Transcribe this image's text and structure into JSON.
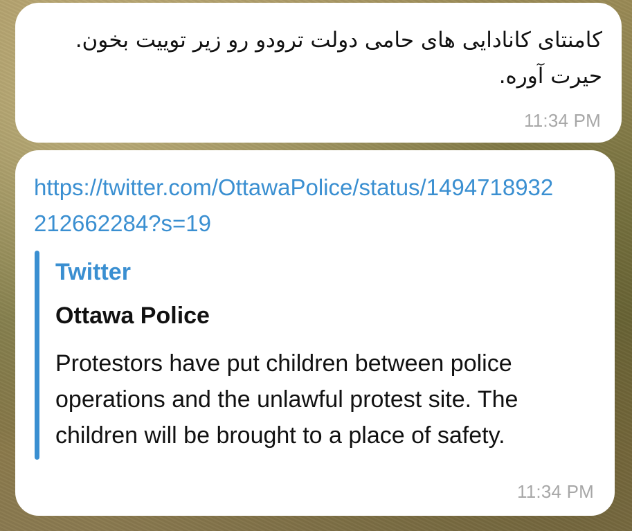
{
  "messages": [
    {
      "text": "کامنتای کانادایی های حامی دولت ترودو رو زیر توییت بخون. حیرت آوره.",
      "time": "11:34 PM"
    },
    {
      "link": "https://twitter.com/OttawaPolice/status/1494718932212662284?s=19",
      "preview": {
        "site": "Twitter",
        "title": "Ottawa Police",
        "description": "Protestors have put children between police operations and the unlawful protest site. The children will be brought to a place of safety."
      },
      "time": "11:34 PM"
    }
  ],
  "colors": {
    "link": "#3a8fd1",
    "bubble": "#ffffff",
    "timestamp": "#a7a7a7"
  }
}
